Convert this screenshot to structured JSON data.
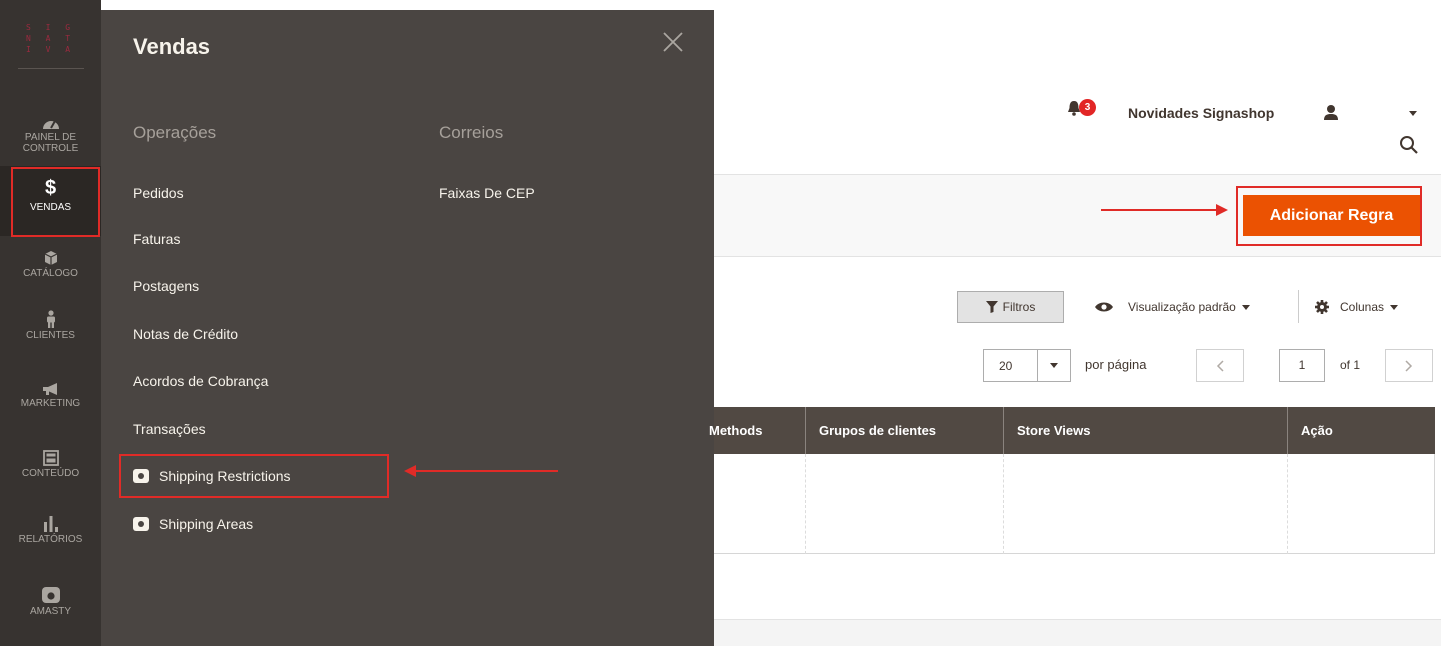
{
  "brand": {
    "logo_rows": [
      "S I G",
      "N A T",
      "I V A"
    ]
  },
  "nav": {
    "items": [
      {
        "label": "PAINEL DE\nCONTROLE",
        "icon": "dashboard-icon"
      },
      {
        "label": "VENDAS",
        "icon": "dollar-icon",
        "active": true
      },
      {
        "label": "CATÁLOGO",
        "icon": "box-icon"
      },
      {
        "label": "CLIENTES",
        "icon": "person-icon"
      },
      {
        "label": "MARKETING",
        "icon": "megaphone-icon"
      },
      {
        "label": "CONTEÚDO",
        "icon": "layout-icon"
      },
      {
        "label": "RELATÓRIOS",
        "icon": "bar-chart-icon"
      },
      {
        "label": "AMASTY",
        "icon": "amasty-icon"
      }
    ]
  },
  "flyout": {
    "title": "Vendas",
    "col1_header": "Operações",
    "col1_items": [
      "Pedidos",
      "Faturas",
      "Postagens",
      "Notas de Crédito",
      "Acordos de Cobrança",
      "Transações"
    ],
    "amasty_items": [
      "Shipping Restrictions",
      "Shipping Areas"
    ],
    "col2_header": "Correios",
    "col2_items": [
      "Faixas De CEP"
    ]
  },
  "header": {
    "notification_count": "3",
    "store_name": "Novidades Signashop"
  },
  "actions": {
    "add_rule": "Adicionar Regra"
  },
  "grid": {
    "filters": "Filtros",
    "default_view": "Visualização padrão",
    "columns": "Colunas",
    "per_page_value": "20",
    "per_page_label": "por página",
    "page_value": "1",
    "page_of": "of 1",
    "headers": [
      "Methods",
      "Grupos de clientes",
      "Store Views",
      "Ação"
    ]
  },
  "colors": {
    "accent": "#eb5202",
    "highlight": "#e02b27",
    "nav_bg": "#373330",
    "flyout_bg": "#4a4542",
    "table_head": "#514943"
  }
}
